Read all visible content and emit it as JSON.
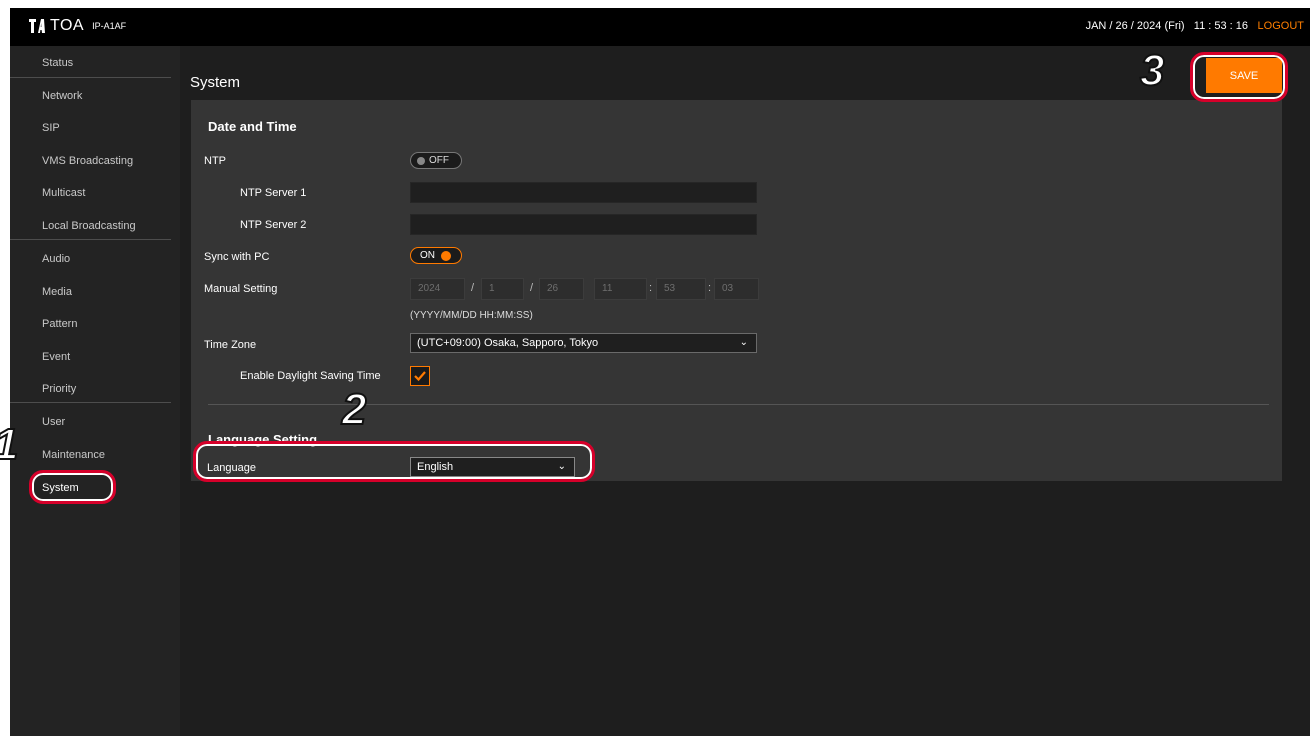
{
  "header": {
    "logo_text": "TOA",
    "model": "IP-A1AF",
    "datetime": "JAN / 26 / 2024 (Fri)   11 : 53 : 16",
    "logout_label": "LOGOUT"
  },
  "sidebar": {
    "items": [
      {
        "label": "Status"
      },
      {
        "label": "Network"
      },
      {
        "label": "SIP"
      },
      {
        "label": "VMS Broadcasting"
      },
      {
        "label": "Multicast"
      },
      {
        "label": "Local Broadcasting"
      },
      {
        "label": "Audio"
      },
      {
        "label": "Media"
      },
      {
        "label": "Pattern"
      },
      {
        "label": "Event"
      },
      {
        "label": "Priority"
      },
      {
        "label": "User"
      },
      {
        "label": "Maintenance"
      },
      {
        "label": "System"
      }
    ],
    "active": "System"
  },
  "page": {
    "title": "System",
    "save_label": "SAVE"
  },
  "date_time": {
    "section_title": "Date and Time",
    "ntp_label": "NTP",
    "ntp_state": "OFF",
    "ntp_server1_label": "NTP Server 1",
    "ntp_server1_value": "",
    "ntp_server2_label": "NTP Server 2",
    "ntp_server2_value": "",
    "sync_label": "Sync with PC",
    "sync_state": "ON",
    "manual_label": "Manual Setting",
    "manual": {
      "year": "2024",
      "month": "1",
      "day": "26",
      "hour": "11",
      "minute": "53",
      "second": "03",
      "date_sep": "/",
      "time_sep": ":"
    },
    "format_hint": "(YYYY/MM/DD HH:MM:SS)",
    "timezone_label": "Time Zone",
    "timezone_value": "(UTC+09:00) Osaka, Sapporo, Tokyo",
    "dst_label": "Enable Daylight Saving Time",
    "dst_checked": true
  },
  "language": {
    "section_title": "Language Setting",
    "label": "Language",
    "value": "English"
  },
  "annotations": {
    "step1": "1",
    "step2": "2",
    "step3": "3",
    "callout_color": "#d6002a"
  },
  "colors": {
    "accent": "#ff7a00",
    "background": "#1e1e1e",
    "panel": "#353535"
  }
}
